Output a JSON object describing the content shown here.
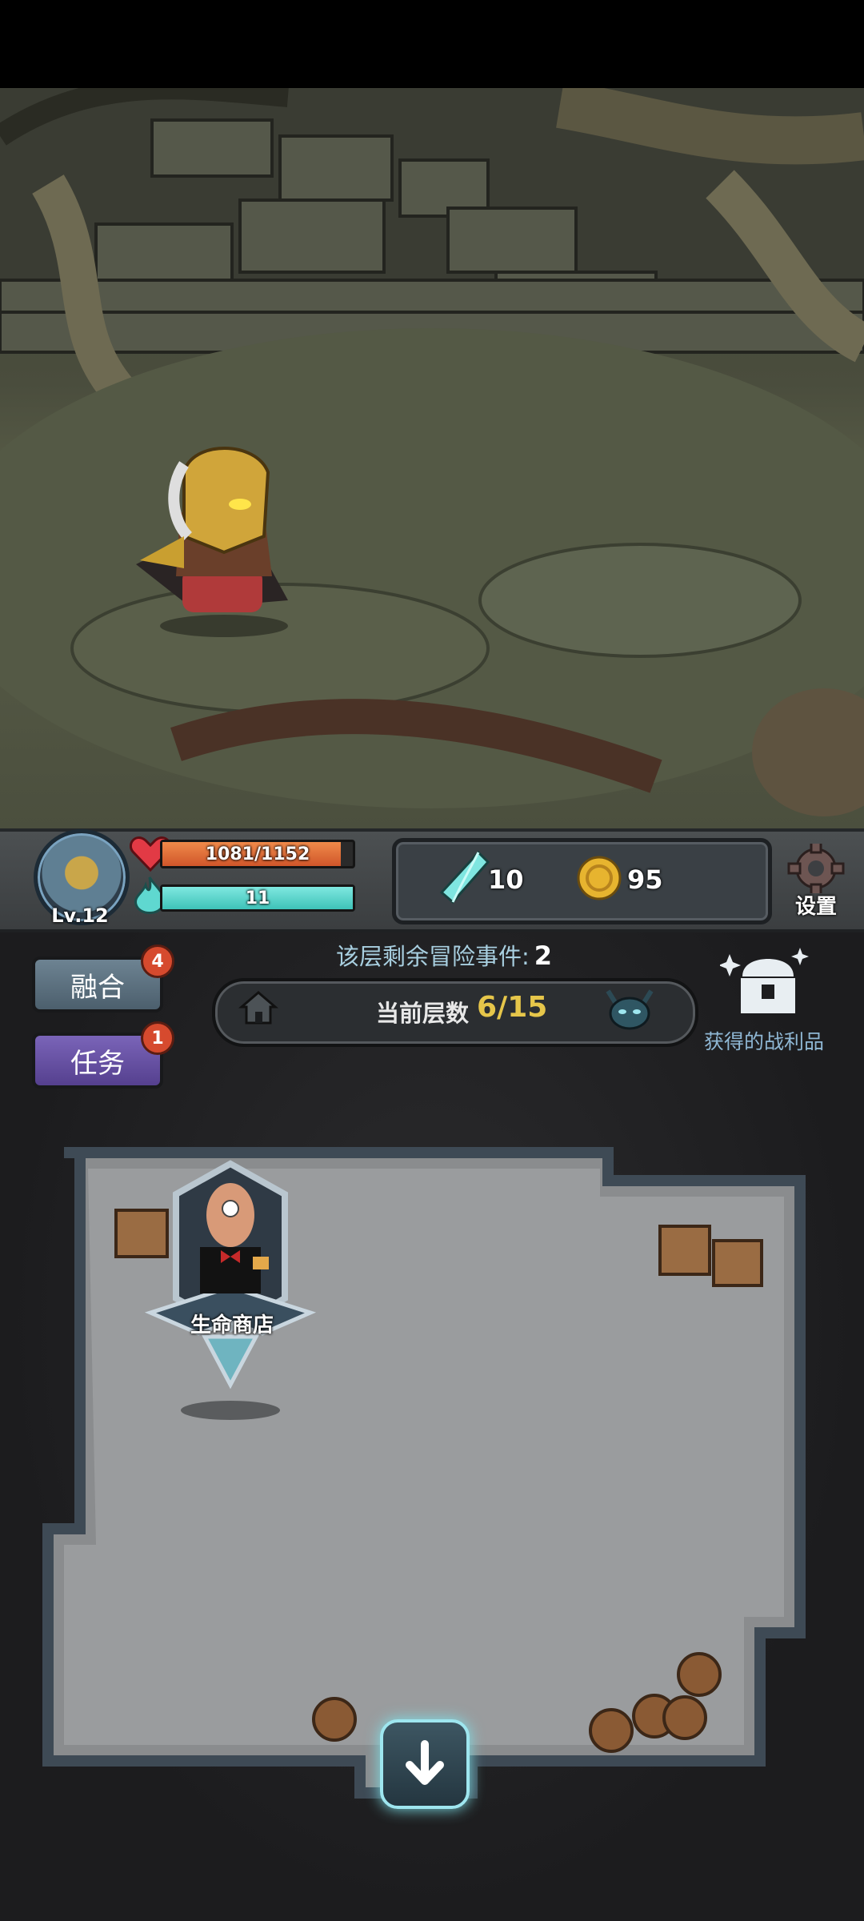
{
  "player": {
    "level": "Lv.12",
    "hp_text": "1081/1152",
    "hp_fraction": 0.938,
    "mp_text": "11",
    "mp_fraction": 1.0
  },
  "resources": {
    "crystals": "10",
    "coins": "95"
  },
  "settings_label": "设置",
  "buttons": {
    "fuse_label": "融合",
    "fuse_badge": "4",
    "task_label": "任务",
    "task_badge": "1"
  },
  "events": {
    "label": "该层剩余冒险事件:",
    "count": "2"
  },
  "floor": {
    "label": "当前层数",
    "value": "6/15"
  },
  "loot_label": "获得的战利品",
  "shop_label": "生命商店",
  "colors": {
    "hp": "#e2693a",
    "mp": "#4fd0c6",
    "floor_value": "#e6c64a",
    "accent_cyan": "#9ee6ef"
  },
  "icons": {
    "hp": "heart-icon",
    "mp": "flame-icon",
    "crystal": "crystal-icon",
    "coin": "coin-icon",
    "settings": "gear-icon",
    "home": "house-icon",
    "boss": "demon-head-icon",
    "loot": "chest-icon",
    "descend": "arrow-down-icon"
  }
}
